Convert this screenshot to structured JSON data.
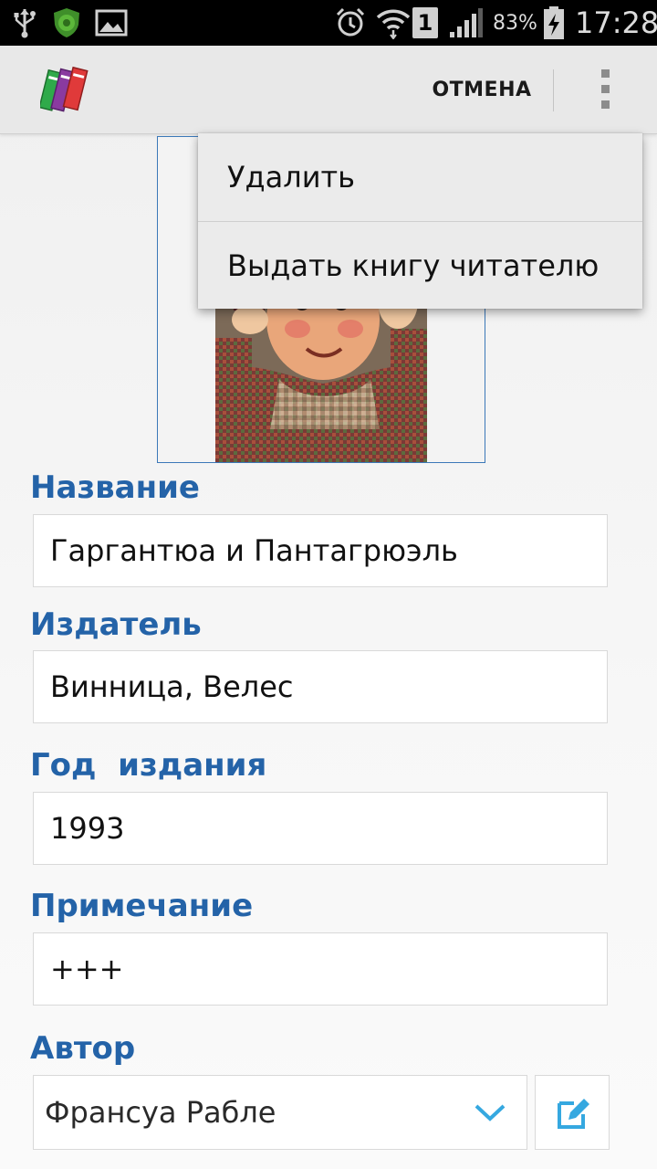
{
  "status_bar": {
    "battery_percent": "83%",
    "time": "17:28",
    "sim_slot": "1",
    "icons": [
      "usb-icon",
      "shield-app-icon",
      "image-notification-icon",
      "alarm-icon",
      "wifi-icon",
      "sim-icon",
      "signal-icon",
      "battery-charging-icon"
    ]
  },
  "action_bar": {
    "cancel_label": "ОТМЕНА",
    "logo_icon": "books-logo-icon",
    "overflow_icon": "overflow-menu-icon"
  },
  "popup_menu": {
    "items": [
      {
        "label": "Удалить"
      },
      {
        "label": "Выдать книгу читателю"
      }
    ]
  },
  "form": {
    "title": {
      "label": "Название",
      "value": "Гаргантюа и Пантагрюэль"
    },
    "publisher": {
      "label": "Издатель",
      "value": "Винница, Велес"
    },
    "year": {
      "label": "Год  издания",
      "value": "1993"
    },
    "note": {
      "label": "Примечание",
      "value": "+++"
    },
    "author": {
      "label": "Автор",
      "value": "Франсуа Рабле"
    }
  },
  "colors": {
    "label_blue": "#2463a8",
    "accent_cyan": "#35a8e0",
    "action_bar_bg": "#e8e8e8",
    "status_bar_bg": "#000000"
  }
}
